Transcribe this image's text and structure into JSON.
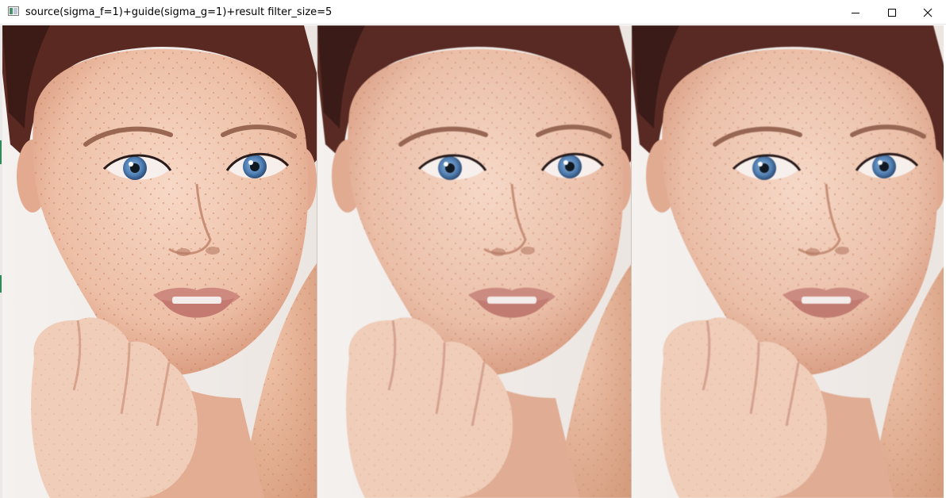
{
  "window": {
    "title": "source(sigma_f=1)+guide(sigma_g=1)+result filter_size=5",
    "icon": "app-window-icon",
    "controls": [
      "minimize-icon",
      "maximize-icon",
      "close-icon"
    ]
  },
  "panels": [
    {
      "role": "source",
      "content": "portrait-photo"
    },
    {
      "role": "guide",
      "content": "portrait-photo-smoothed"
    },
    {
      "role": "result",
      "content": "portrait-photo-filtered"
    }
  ],
  "colors": {
    "titlebar_bg": "#ffffff",
    "skin": "#f1c8b2",
    "hair": "#5a2a22",
    "iris": "#4f7fb4",
    "lips": "#cf8a80"
  }
}
